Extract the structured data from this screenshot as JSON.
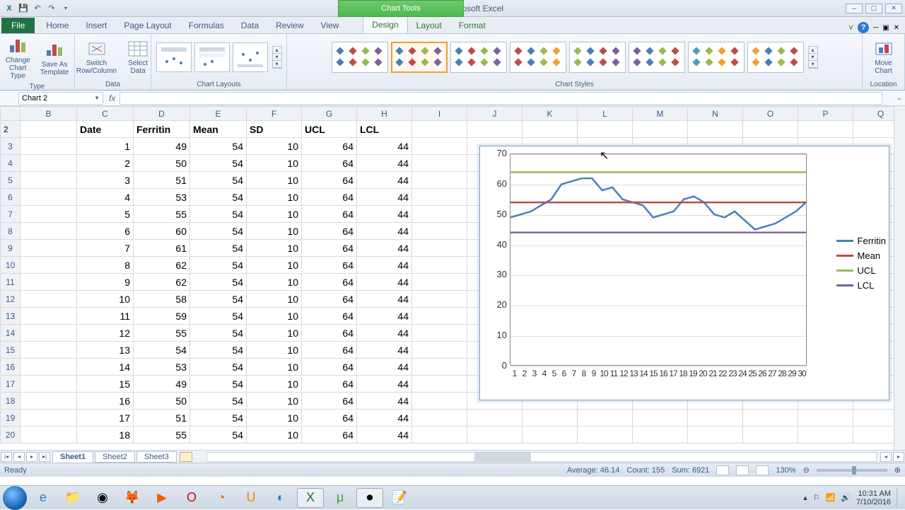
{
  "app": {
    "title": "Book1 - Microsoft Excel",
    "contextual_tab_title": "Chart Tools"
  },
  "qat": {
    "save": "💾",
    "undo": "↶",
    "redo": "↷"
  },
  "tabs": {
    "file": "File",
    "home": "Home",
    "insert": "Insert",
    "page_layout": "Page Layout",
    "formulas": "Formulas",
    "data": "Data",
    "review": "Review",
    "view": "View",
    "design": "Design",
    "layout": "Layout",
    "format": "Format"
  },
  "ribbon": {
    "type_group": "Type",
    "change_chart_type": "Change\nChart Type",
    "save_as_template": "Save As\nTemplate",
    "data_group": "Data",
    "switch_rc": "Switch\nRow/Column",
    "select_data": "Select\nData",
    "layouts_group": "Chart Layouts",
    "styles_group": "Chart Styles",
    "location_group": "Location",
    "move_chart": "Move\nChart"
  },
  "namebox": "Chart 2",
  "fx_label": "fx",
  "columns": [
    "B",
    "C",
    "D",
    "E",
    "F",
    "G",
    "H",
    "I",
    "J",
    "K",
    "L",
    "M",
    "N",
    "O",
    "P",
    "Q"
  ],
  "row_start": 2,
  "row_end": 20,
  "headers": {
    "C": "Date",
    "D": "Ferritin",
    "E": "Mean",
    "F": "SD",
    "G": "UCL",
    "H": "LCL"
  },
  "rows": [
    {
      "C": 1,
      "D": 49,
      "E": 54,
      "F": 10,
      "G": 64,
      "H": 44
    },
    {
      "C": 2,
      "D": 50,
      "E": 54,
      "F": 10,
      "G": 64,
      "H": 44
    },
    {
      "C": 3,
      "D": 51,
      "E": 54,
      "F": 10,
      "G": 64,
      "H": 44
    },
    {
      "C": 4,
      "D": 53,
      "E": 54,
      "F": 10,
      "G": 64,
      "H": 44
    },
    {
      "C": 5,
      "D": 55,
      "E": 54,
      "F": 10,
      "G": 64,
      "H": 44
    },
    {
      "C": 6,
      "D": 60,
      "E": 54,
      "F": 10,
      "G": 64,
      "H": 44
    },
    {
      "C": 7,
      "D": 61,
      "E": 54,
      "F": 10,
      "G": 64,
      "H": 44
    },
    {
      "C": 8,
      "D": 62,
      "E": 54,
      "F": 10,
      "G": 64,
      "H": 44
    },
    {
      "C": 9,
      "D": 62,
      "E": 54,
      "F": 10,
      "G": 64,
      "H": 44
    },
    {
      "C": 10,
      "D": 58,
      "E": 54,
      "F": 10,
      "G": 64,
      "H": 44
    },
    {
      "C": 11,
      "D": 59,
      "E": 54,
      "F": 10,
      "G": 64,
      "H": 44
    },
    {
      "C": 12,
      "D": 55,
      "E": 54,
      "F": 10,
      "G": 64,
      "H": 44
    },
    {
      "C": 13,
      "D": 54,
      "E": 54,
      "F": 10,
      "G": 64,
      "H": 44
    },
    {
      "C": 14,
      "D": 53,
      "E": 54,
      "F": 10,
      "G": 64,
      "H": 44
    },
    {
      "C": 15,
      "D": 49,
      "E": 54,
      "F": 10,
      "G": 64,
      "H": 44
    },
    {
      "C": 16,
      "D": 50,
      "E": 54,
      "F": 10,
      "G": 64,
      "H": 44
    },
    {
      "C": 17,
      "D": 51,
      "E": 54,
      "F": 10,
      "G": 64,
      "H": 44
    },
    {
      "C": 18,
      "D": 55,
      "E": 54,
      "F": 10,
      "G": 64,
      "H": 44
    }
  ],
  "chart_data": {
    "type": "line",
    "x": [
      1,
      2,
      3,
      4,
      5,
      6,
      7,
      8,
      9,
      10,
      11,
      12,
      13,
      14,
      15,
      16,
      17,
      18,
      19,
      20,
      21,
      22,
      23,
      24,
      25,
      26,
      27,
      28,
      29,
      30
    ],
    "series": [
      {
        "name": "Ferritin",
        "color": "#4a7ebb",
        "values": [
          49,
          50,
          51,
          53,
          55,
          60,
          61,
          62,
          62,
          58,
          59,
          55,
          54,
          53,
          49,
          50,
          51,
          55,
          56,
          54,
          50,
          49,
          51,
          48,
          45,
          46,
          47,
          49,
          51,
          54
        ]
      },
      {
        "name": "Mean",
        "color": "#be4b48",
        "values": [
          54,
          54,
          54,
          54,
          54,
          54,
          54,
          54,
          54,
          54,
          54,
          54,
          54,
          54,
          54,
          54,
          54,
          54,
          54,
          54,
          54,
          54,
          54,
          54,
          54,
          54,
          54,
          54,
          54,
          54
        ]
      },
      {
        "name": "UCL",
        "color": "#98b954",
        "values": [
          64,
          64,
          64,
          64,
          64,
          64,
          64,
          64,
          64,
          64,
          64,
          64,
          64,
          64,
          64,
          64,
          64,
          64,
          64,
          64,
          64,
          64,
          64,
          64,
          64,
          64,
          64,
          64,
          64,
          64
        ]
      },
      {
        "name": "LCL",
        "color": "#7d60a0",
        "values": [
          44,
          44,
          44,
          44,
          44,
          44,
          44,
          44,
          44,
          44,
          44,
          44,
          44,
          44,
          44,
          44,
          44,
          44,
          44,
          44,
          44,
          44,
          44,
          44,
          44,
          44,
          44,
          44,
          44,
          44
        ]
      }
    ],
    "ylim": [
      0,
      70
    ],
    "yticks": [
      0,
      10,
      20,
      30,
      40,
      50,
      60,
      70
    ],
    "legend": [
      "Ferritin",
      "Mean",
      "UCL",
      "LCL"
    ]
  },
  "sheets": {
    "s1": "Sheet1",
    "s2": "Sheet2",
    "s3": "Sheet3"
  },
  "status": {
    "ready": "Ready",
    "average": "Average: 46.14",
    "count": "Count: 155",
    "sum": "Sum: 6921",
    "zoom": "130%"
  },
  "tray": {
    "time": "10:31 AM",
    "date": "7/10/2016"
  }
}
